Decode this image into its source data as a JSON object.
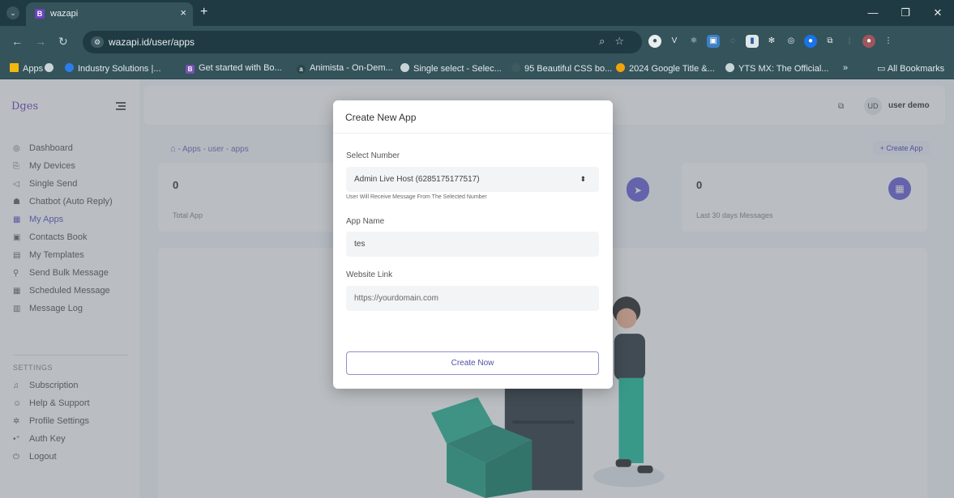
{
  "browser": {
    "tab_title": "wazapi",
    "tab_close": "×",
    "new_tab": "+",
    "url": "wazapi.id/user/apps",
    "window_controls": [
      "—",
      "❐",
      "✕"
    ],
    "bookmarks": [
      {
        "label": "Apps",
        "icon_color": "#f2b90b",
        "icon": "apps-grid"
      },
      {
        "label": "",
        "icon_color": "#c9d4d7",
        "icon": "globe"
      },
      {
        "label": "Industry Solutions |...",
        "icon_color": "#2b7de9",
        "icon": "site"
      },
      {
        "label": "Get started with Bo...",
        "icon_color": "#7952b3",
        "icon": "bootstrap"
      },
      {
        "label": "Animista - On-Dem...",
        "icon_color": "#34535b",
        "icon": "animista"
      },
      {
        "label": "Single select - Selec...",
        "icon_color": "#c9d4d7",
        "icon": "globe"
      },
      {
        "label": "95 Beautiful CSS bo...",
        "icon_color": "#3e5a62",
        "icon": "site"
      },
      {
        "label": "2024 Google Title &...",
        "icon_color": "#f0a30a",
        "icon": "site"
      },
      {
        "label": "YTS MX: The Official...",
        "icon_color": "#c9d4d7",
        "icon": "globe"
      }
    ],
    "bookmarks_overflow": "»",
    "all_bookmarks": "All Bookmarks"
  },
  "sidebar": {
    "logo": "Dges",
    "menu": [
      {
        "label": "Dashboard",
        "icon": "dashboard-icon",
        "glyph": "◎"
      },
      {
        "label": "My Devices",
        "icon": "devices-icon",
        "glyph": "⎘"
      },
      {
        "label": "Single Send",
        "icon": "send-icon",
        "glyph": "◁"
      },
      {
        "label": "Chatbot (Auto Reply)",
        "icon": "robot-icon",
        "glyph": "☗"
      },
      {
        "label": "My Apps",
        "icon": "apps-icon",
        "glyph": "▦"
      },
      {
        "label": "Contacts Book",
        "icon": "contacts-icon",
        "glyph": "▣"
      },
      {
        "label": "My Templates",
        "icon": "templates-icon",
        "glyph": "▤"
      },
      {
        "label": "Send Bulk Message",
        "icon": "rocket-icon",
        "glyph": "⚲"
      },
      {
        "label": "Scheduled Message",
        "icon": "calendar-icon",
        "glyph": "▦"
      },
      {
        "label": "Message Log",
        "icon": "log-icon",
        "glyph": "▥"
      }
    ],
    "settings_header": "SETTINGS",
    "settings_menu": [
      {
        "label": "Subscription",
        "icon": "subscription-icon",
        "glyph": "♫"
      },
      {
        "label": "Help & Support",
        "icon": "support-icon",
        "glyph": "☺"
      },
      {
        "label": "Profile Settings",
        "icon": "gear-icon",
        "glyph": "✲"
      },
      {
        "label": "Auth Key",
        "icon": "key-icon",
        "glyph": "•⁺"
      },
      {
        "label": "Logout",
        "icon": "power-icon",
        "glyph": "⏻"
      }
    ]
  },
  "header": {
    "avatar_initials": "UD",
    "user_name": "user demo"
  },
  "breadcrumb": {
    "home": "🏠",
    "text": "- Apps - user - apps"
  },
  "create_app_button": "+ Create App",
  "stats": [
    {
      "value": "0",
      "label": "Total App"
    },
    {
      "value": "0",
      "label": "Last 30 days Messages"
    }
  ],
  "modal": {
    "title": "Create New App",
    "number_label": "Select Number",
    "number_value": "Admin Live Host (6285175177517)",
    "number_help": "User Will Receive Message From The Selected Number",
    "app_name_label": "App Name",
    "app_name_value": "tes",
    "website_label": "Website Link",
    "website_placeholder": "https://yourdomain.com",
    "submit": "Create Now"
  },
  "colors": {
    "accent": "#6c63d9",
    "chrome": "#1f3a42",
    "chrome_tab": "#34535b"
  }
}
